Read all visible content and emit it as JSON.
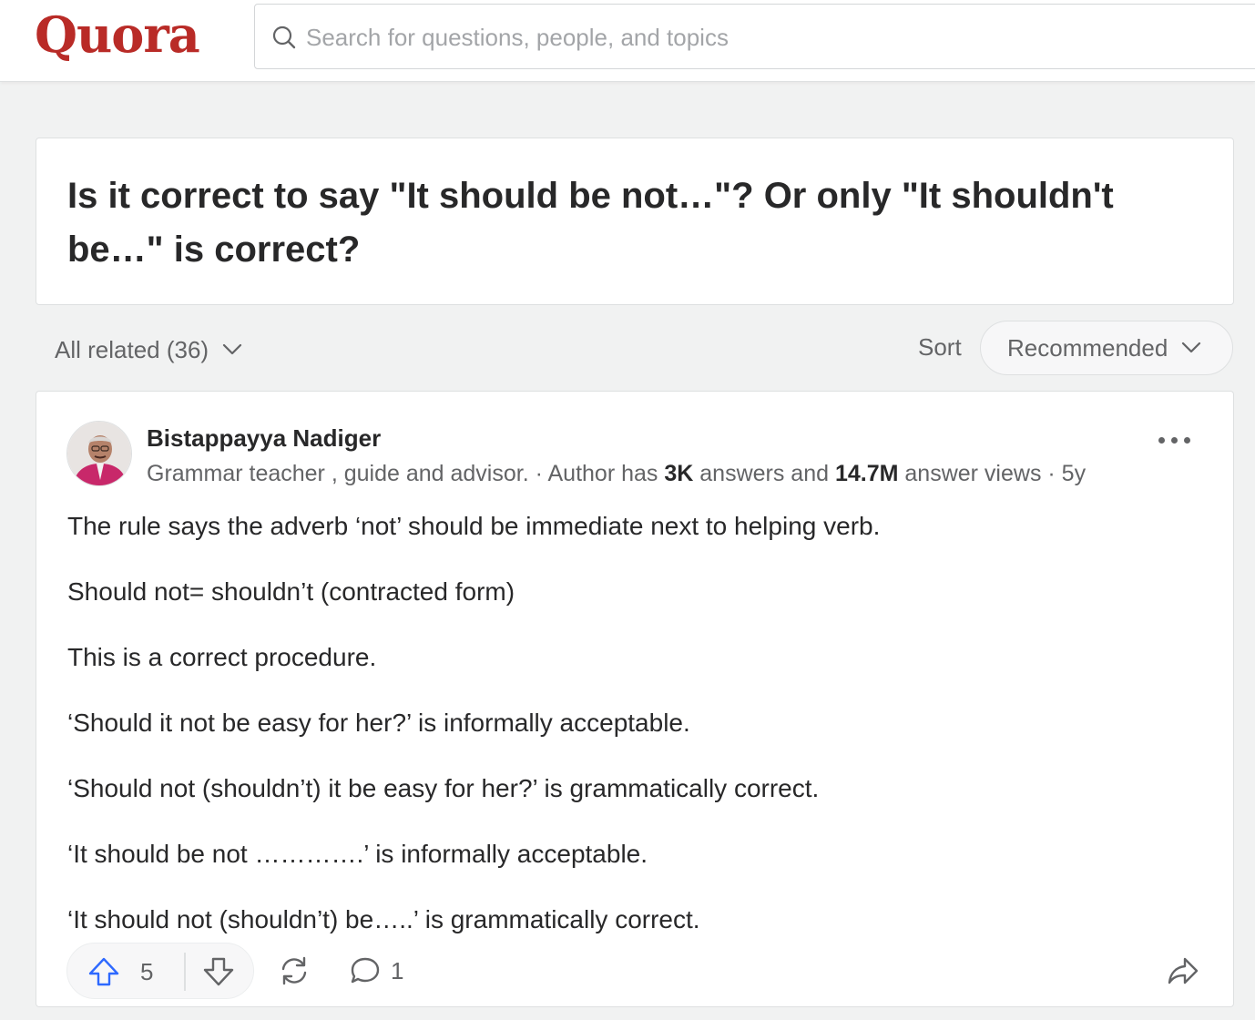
{
  "header": {
    "logo": "Quora",
    "search_placeholder": "Search for questions, people, and topics"
  },
  "question": {
    "title": "Is it correct to say \"It should be not…\"? Or only \"It shouldn't be…\" is correct?"
  },
  "filters": {
    "all_related": "All related (36)",
    "sort_label": "Sort",
    "sort_value": "Recommended"
  },
  "answer": {
    "author_name": "Bistappayya Nadiger",
    "credential": "Grammar teacher , guide and advisor. · Author has ",
    "answers_count": "3K",
    "answers_mid": " answers and ",
    "views_count": "14.7M",
    "views_suffix": " answer views · 5y",
    "paragraphs": [
      "The rule says the adverb ‘not’ should be immediate next to helping verb.",
      "Should not= shouldn’t (contracted form)",
      "This is a correct procedure.",
      "‘Should it not be easy for her?’ is informally acceptable.",
      "‘Should not (shouldn’t) it be easy for her?’ is grammatically correct.",
      "‘It should be not ………….’ is informally acceptable.",
      "‘It should not (shouldn’t) be…..’ is grammatically correct."
    ],
    "upvotes": "5",
    "comments": "1"
  },
  "colors": {
    "brand": "#b92b27",
    "upvote_blue": "#2e69ff",
    "page_bg": "#f1f2f2"
  },
  "icons": [
    "search-icon",
    "chevron-down-icon",
    "more-icon",
    "upvote-icon",
    "downvote-icon",
    "reshare-icon",
    "comment-icon",
    "share-icon"
  ]
}
